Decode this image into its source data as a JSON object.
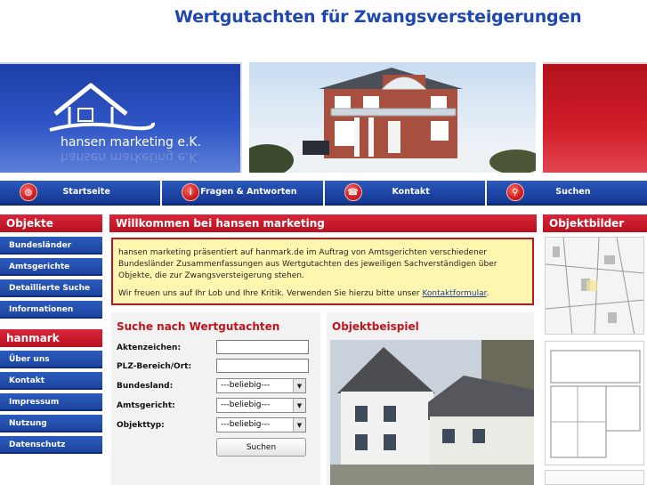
{
  "header": {
    "title": "Wertgutachten für Zwangsversteigerungen"
  },
  "logo": {
    "text": "hansen marketing e.K."
  },
  "nav": [
    {
      "label": "Startseite",
      "icon": "globe-icon"
    },
    {
      "label": "Fragen & Antworten",
      "icon": "info-icon"
    },
    {
      "label": "Kontakt",
      "icon": "phone-icon"
    },
    {
      "label": "Suchen",
      "icon": "magnifier-icon"
    }
  ],
  "sidebar": {
    "objekte_title": "Objekte",
    "objekte_items": [
      "Bundesländer",
      "Amtsgerichte",
      "Detaillierte Suche",
      "Informationen"
    ],
    "hanmark_title": "hanmark",
    "hanmark_items": [
      "Über uns",
      "Kontakt",
      "Impressum",
      "Nutzung",
      "Datenschutz"
    ]
  },
  "main": {
    "welcome_title": "Willkommen bei hansen marketing",
    "intro": "hansen marketing präsentiert auf hanmark.de im Auftrag von Amtsgerichten verschiedener Bundesländer Zusammenfassungen aus Wertgutachten des jeweiligen Sachverständigen über Objekte, die zur Zwangsversteigerung stehen.",
    "feedback_prefix": "Wir freuen uns auf Ihr Lob und Ihre Kritik. Verwenden Sie hierzu bitte unser ",
    "feedback_link": "Kontaktformular",
    "feedback_suffix": "."
  },
  "search": {
    "title": "Suche nach Wertgutachten",
    "aktenzeichen_label": "Aktenzeichen:",
    "aktenzeichen_value": "",
    "plz_label": "PLZ-Bereich/Ort:",
    "plz_value": "",
    "bundesland_label": "Bundesland:",
    "bundesland_value": "---beliebig---",
    "amtsgericht_label": "Amtsgericht:",
    "amtsgericht_value": "---beliebig---",
    "objekttyp_label": "Objekttyp:",
    "objekttyp_value": "---beliebig---",
    "button": "Suchen"
  },
  "example": {
    "title": "Objektbeispiel"
  },
  "objektbilder": {
    "title": "Objektbilder"
  },
  "colors": {
    "title_blue": "#1f47b0",
    "nav_blue": "#1f47a8",
    "accent_red": "#c0141e",
    "welcome_yellow": "#fff7b0"
  }
}
